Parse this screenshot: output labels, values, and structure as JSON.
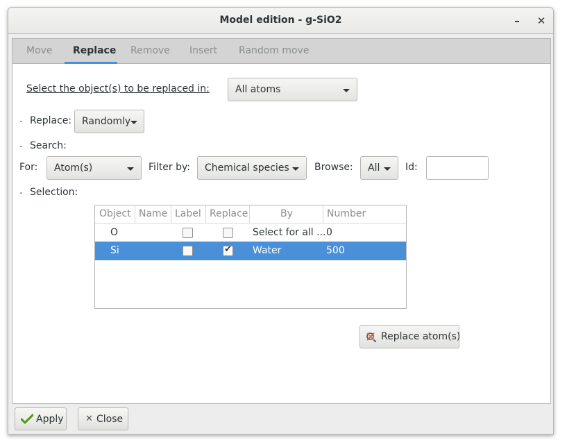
{
  "window": {
    "title": "Model edition - g-SiO2",
    "minimize": "–",
    "close": "✕"
  },
  "tabs": [
    "Move",
    "Replace",
    "Remove",
    "Insert",
    "Random move"
  ],
  "select_objects": {
    "label": "Select the object(s) to be replaced in:",
    "value": "All atoms"
  },
  "bullet": ".",
  "replace": {
    "label": "Replace:",
    "value": "Randomly"
  },
  "search": {
    "label": "Search:",
    "for_label": "For:",
    "for_value": "Atom(s)",
    "filter_label": "Filter by:",
    "filter_value": "Chemical species",
    "browse_label": "Browse:",
    "browse_value": "All",
    "id_label": "Id:",
    "id_value": ""
  },
  "selection": {
    "label": "Selection:",
    "columns": [
      "Object",
      "Name",
      "Label",
      "Replace",
      "By",
      "Number"
    ],
    "rows": [
      {
        "object": "O",
        "name": "",
        "label_checked": false,
        "replace_checked": false,
        "by": "Select for all ...",
        "number": "0",
        "selected": false
      },
      {
        "object": "Si",
        "name": "",
        "label_checked": false,
        "replace_checked": true,
        "by": "Water",
        "number": "500",
        "selected": true
      }
    ]
  },
  "replace_button": "Replace atom(s)",
  "footer": {
    "apply": "Apply",
    "close": "Close"
  },
  "colors": {
    "accent": "#4a90d9",
    "window_bg": "#ededed",
    "tab_bar": "#d4d4d4"
  }
}
